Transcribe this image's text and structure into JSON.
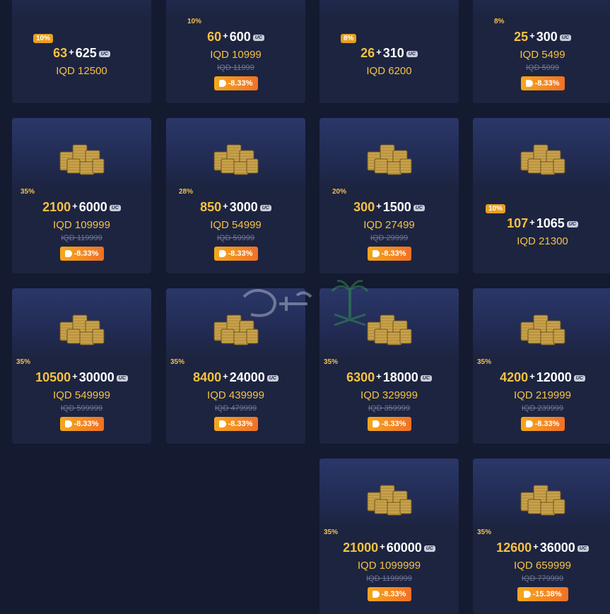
{
  "cards": [
    {
      "bonus": "10%",
      "bonus_badge": true,
      "base": "63",
      "extra": "625",
      "price": "IQD 12500",
      "old": "",
      "discount": "",
      "has_image": false
    },
    {
      "bonus": "10%",
      "bonus_badge": false,
      "base": "60",
      "extra": "600",
      "price": "IQD 10999",
      "old": "IQD 11999",
      "discount": "-8.33%",
      "has_image": false
    },
    {
      "bonus": "8%",
      "bonus_badge": true,
      "base": "26",
      "extra": "310",
      "price": "IQD 6200",
      "old": "",
      "discount": "",
      "has_image": false
    },
    {
      "bonus": "8%",
      "bonus_badge": false,
      "base": "25",
      "extra": "300",
      "price": "IQD 5499",
      "old": "IQD 5999",
      "discount": "-8.33%",
      "has_image": false
    },
    {
      "bonus": "35%",
      "bonus_badge": false,
      "base": "2100",
      "extra": "6000",
      "price": "IQD 109999",
      "old": "IQD 119999",
      "discount": "-8.33%",
      "has_image": true
    },
    {
      "bonus": "28%",
      "bonus_badge": false,
      "base": "850",
      "extra": "3000",
      "price": "IQD 54999",
      "old": "IQD 59999",
      "discount": "-8.33%",
      "has_image": true
    },
    {
      "bonus": "20%",
      "bonus_badge": false,
      "base": "300",
      "extra": "1500",
      "price": "IQD 27499",
      "old": "IQD 29999",
      "discount": "-8.33%",
      "has_image": true
    },
    {
      "bonus": "10%",
      "bonus_badge": true,
      "base": "107",
      "extra": "1065",
      "price": "IQD 21300",
      "old": "",
      "discount": "",
      "has_image": true
    },
    {
      "bonus": "35%",
      "bonus_badge": false,
      "base": "10500",
      "extra": "30000",
      "price": "IQD 549999",
      "old": "IQD 599999",
      "discount": "-8.33%",
      "has_image": true
    },
    {
      "bonus": "35%",
      "bonus_badge": false,
      "base": "8400",
      "extra": "24000",
      "price": "IQD 439999",
      "old": "IQD 479999",
      "discount": "-8.33%",
      "has_image": true
    },
    {
      "bonus": "35%",
      "bonus_badge": false,
      "base": "6300",
      "extra": "18000",
      "price": "IQD 329999",
      "old": "IQD 359999",
      "discount": "-8.33%",
      "has_image": true
    },
    {
      "bonus": "35%",
      "bonus_badge": false,
      "base": "4200",
      "extra": "12000",
      "price": "IQD 219999",
      "old": "IQD 239999",
      "discount": "-8.33%",
      "has_image": true
    },
    {
      "bonus": "35%",
      "bonus_badge": false,
      "base": "21000",
      "extra": "60000",
      "price": "IQD 1099999",
      "old": "IQD 1199999",
      "discount": "-8.33%",
      "has_image": true
    },
    {
      "bonus": "35%",
      "bonus_badge": false,
      "base": "12600",
      "extra": "36000",
      "price": "IQD 659999",
      "old": "IQD 779999",
      "discount": "-15.38%",
      "has_image": true
    }
  ],
  "currency_label": "UC",
  "colors": {
    "background": "#141a30",
    "card": "#1d2440",
    "gold": "#f5c242",
    "discount_start": "#f6a71c",
    "discount_end": "#f27026"
  }
}
